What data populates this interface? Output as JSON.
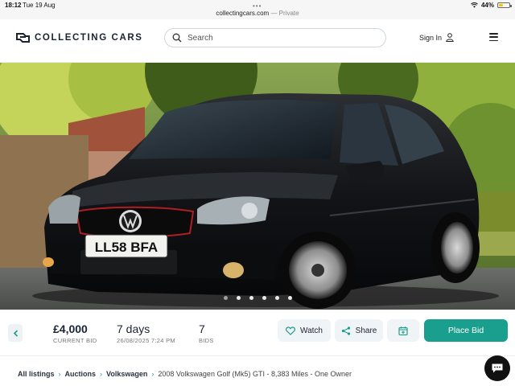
{
  "status_bar": {
    "time": "18:12",
    "date": "Tue 19 Aug",
    "url": "collectingcars.com",
    "privacy": "— Private",
    "battery": "44%",
    "battery_level": 0.44,
    "battery_color": "#f5c400"
  },
  "header": {
    "brand": "COLLECTING CARS",
    "search_placeholder": "Search",
    "sign_in": "Sign In",
    "icons": [
      "search-icon",
      "user-icon",
      "menu-icon"
    ]
  },
  "hero": {
    "plate": "LL58 BFA",
    "badge": "GTI",
    "image_count": 6,
    "active_index": 0
  },
  "bid_bar": {
    "current_bid": "£4,000",
    "current_bid_label": "CURRENT BID",
    "time_left": "7 days",
    "end_date": "26/08/2025 7:24 PM",
    "bids": "7",
    "bids_label": "BIDS",
    "watch": "Watch",
    "share": "Share",
    "place_bid": "Place Bid",
    "accent_color": "#1a9e8e"
  },
  "breadcrumb": {
    "items": [
      "All listings",
      "Auctions",
      "Volkswagen"
    ],
    "current": "2008 Volkswagen Golf (Mk5) GTI - 8,383 Miles - One Owner"
  }
}
